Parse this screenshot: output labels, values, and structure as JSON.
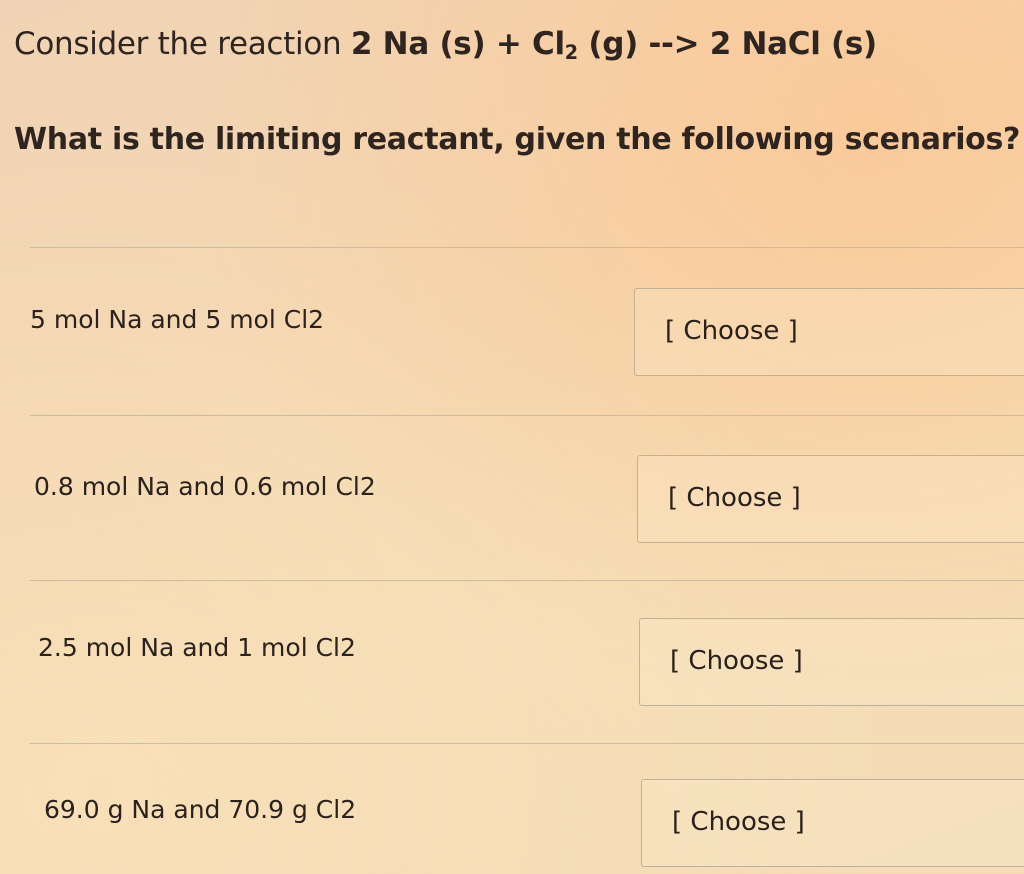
{
  "question": {
    "intro": "Consider the reaction",
    "equation_part1": "2 Na (s) + Cl",
    "equation_sub": "2",
    "equation_part2": " (g) --> 2 NaCl (s)",
    "prompt": "What is the limiting reactant, given the following scenarios?"
  },
  "scenarios": [
    {
      "label": "5 mol Na and 5 mol Cl2",
      "select_value": "[ Choose ]"
    },
    {
      "label": "0.8 mol Na and 0.6 mol Cl2",
      "select_value": "[ Choose ]"
    },
    {
      "label": "2.5 mol Na and 1 mol Cl2",
      "select_value": "[ Choose ]"
    },
    {
      "label": "69.0 g Na and 70.9 g Cl2",
      "select_value": "[ Choose ]"
    }
  ]
}
